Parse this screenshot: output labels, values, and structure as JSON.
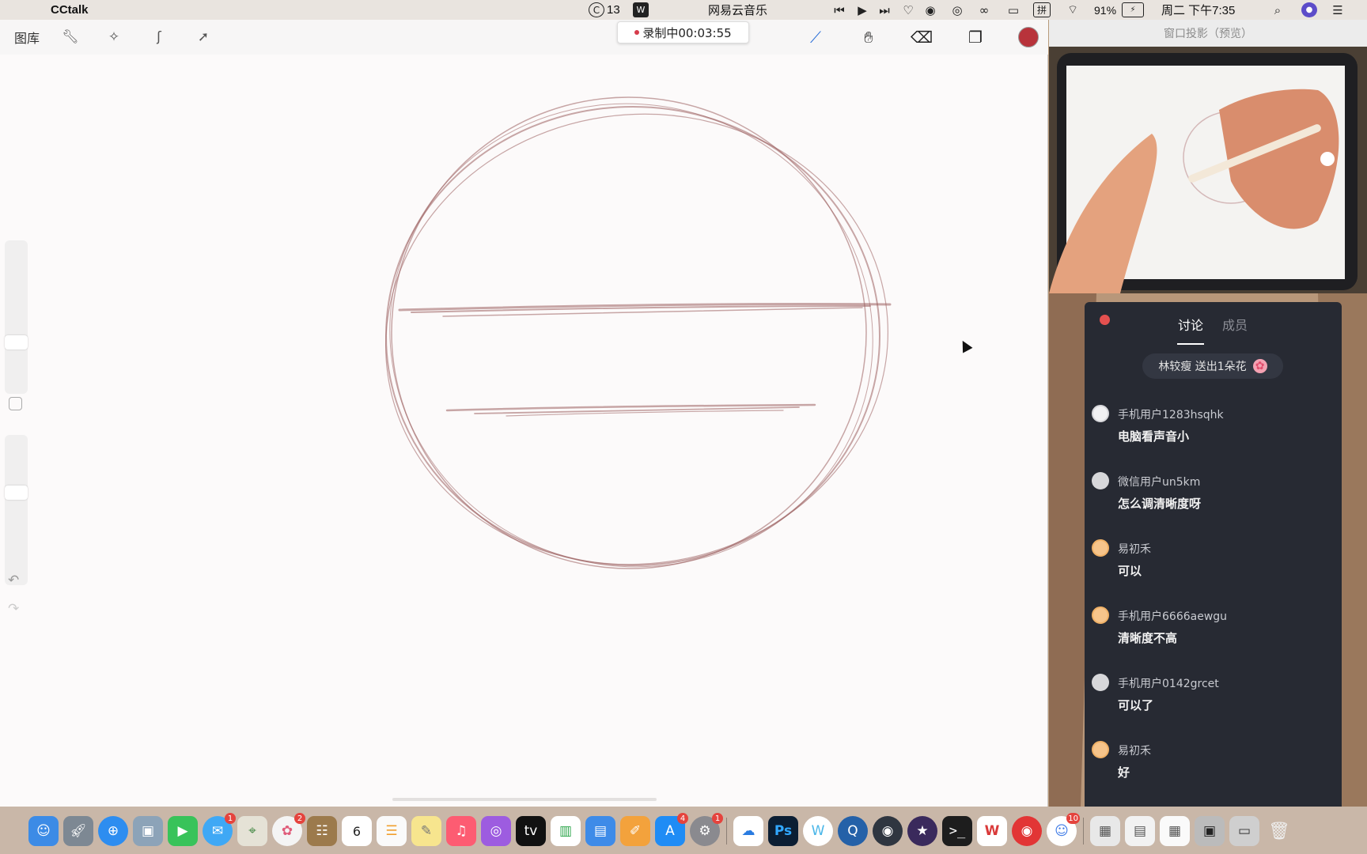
{
  "menubar": {
    "app_name": "CCtalk",
    "center_title": "网易云音乐",
    "cc_count": "13",
    "battery": "91%",
    "clock": "周二 下午7:35",
    "ime": "拼"
  },
  "toolbar": {
    "gallery_label": "图库",
    "recording_text": "录制中00:03:55",
    "active_color": "#b8333b",
    "icons": [
      "wrench-icon",
      "magic-wand-icon",
      "selection-icon",
      "transform-arrow-icon",
      "brush-icon",
      "smudge-icon",
      "eraser-icon",
      "layers-icon",
      "color-swatch"
    ]
  },
  "projection": {
    "header": "窗口投影（预览）"
  },
  "chat": {
    "tabs": [
      "讨论",
      "成员"
    ],
    "gift": {
      "text": "林较瘦 送出1朵花"
    },
    "messages": [
      {
        "avatar": "snow",
        "name": "手机用户1283hsqhk",
        "text": "电脑看声音小"
      },
      {
        "avatar": "gray",
        "name": "微信用户un5km",
        "text": "怎么调清晰度呀"
      },
      {
        "avatar": "cat",
        "name": "易初禾",
        "text": "可以"
      },
      {
        "avatar": "cat",
        "name": "手机用户6666aewgu",
        "text": "清晰度不高"
      },
      {
        "avatar": "gray",
        "name": "手机用户0142grcet",
        "text": "可以了"
      },
      {
        "avatar": "cat",
        "name": "易初禾",
        "text": "好"
      }
    ]
  },
  "dock": {
    "calendar_day": "6",
    "badges": {
      "messages": "1",
      "photos": "2",
      "appstore": "4",
      "settings": "1",
      "cctalk": "10"
    }
  }
}
